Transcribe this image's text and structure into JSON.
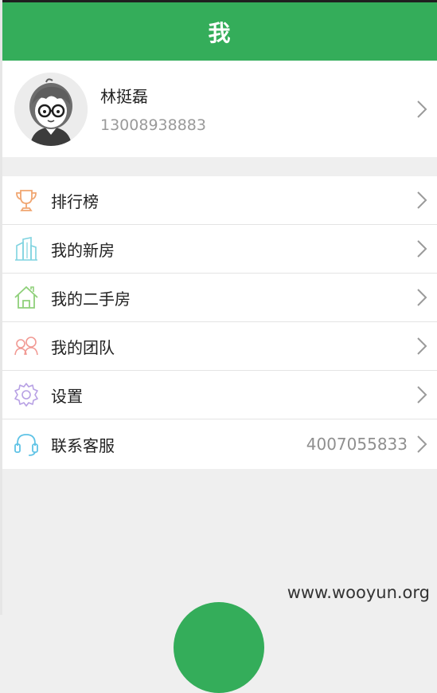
{
  "header": {
    "title": "我"
  },
  "profile": {
    "name": "林挺磊",
    "phone": "13008938883"
  },
  "menu": {
    "items": [
      {
        "label": "排行榜",
        "icon": "trophy-icon"
      },
      {
        "label": "我的新房",
        "icon": "buildings-icon"
      },
      {
        "label": "我的二手房",
        "icon": "house-icon"
      },
      {
        "label": "我的团队",
        "icon": "team-icon"
      },
      {
        "label": "设置",
        "icon": "gear-icon"
      },
      {
        "label": "联系客服",
        "icon": "headset-icon",
        "value": "4007055833"
      }
    ]
  },
  "watermark": "www.wooyun.org",
  "colors": {
    "accent": "#34ad5a",
    "trophy": "#f0a671",
    "buildings": "#7fd3e0",
    "house": "#8fd07a",
    "team": "#f19a94",
    "gear": "#b7a0e4",
    "headset": "#5fc3e6"
  }
}
